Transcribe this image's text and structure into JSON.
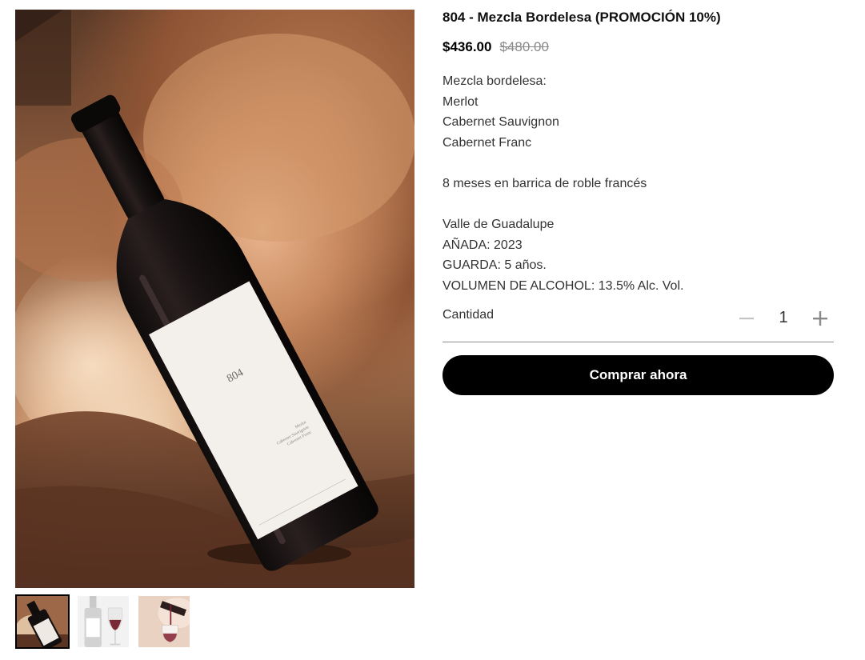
{
  "product": {
    "title": "804 - Mezcla Bordelesa (PROMOCIÓN 10%)",
    "price_current": "$436.00",
    "price_old": "$480.00",
    "description_lines": [
      "Mezcla bordelesa:",
      "Merlot",
      "Cabernet Sauvignon",
      "Cabernet Franc",
      "",
      "8 meses en barrica de roble francés",
      "",
      "Valle de Guadalupe",
      "AÑADA: 2023",
      "GUARDA: 5 años.",
      "VOLUMEN DE ALCOHOL: 13.5% Alc. Vol."
    ],
    "label_text": "804",
    "label_grapes": "Merlot Cabernet Sauvignon Cabernet Franc"
  },
  "quantity": {
    "label": "Cantidad",
    "value": "1",
    "minus_symbol": "−",
    "plus_symbol": "+"
  },
  "actions": {
    "buy_label": "Comprar ahora"
  },
  "gallery": {
    "thumbnails": [
      {
        "icon": "bottle-on-rock-thumbnail",
        "active": true
      },
      {
        "icon": "bottle-and-glass-thumbnail",
        "active": false
      },
      {
        "icon": "wine-pouring-thumbnail",
        "active": false
      }
    ]
  },
  "colors": {
    "button_bg": "#000000",
    "button_text": "#ffffff",
    "price_old": "#8a8a8a",
    "divider": "#8e8e8e"
  }
}
